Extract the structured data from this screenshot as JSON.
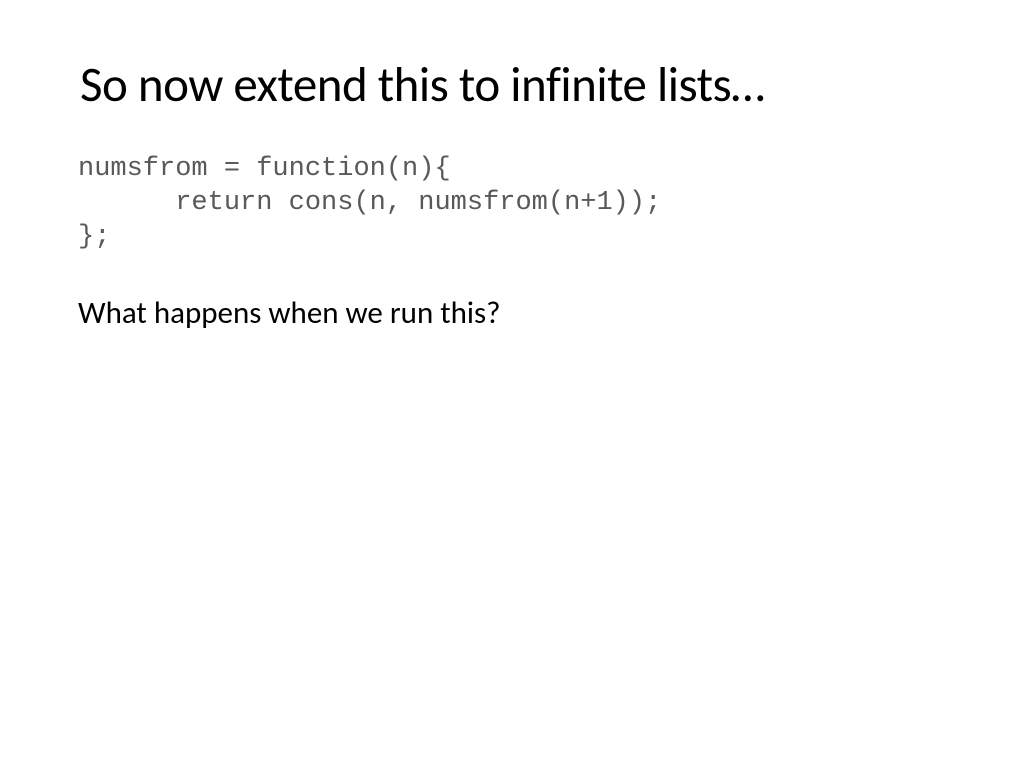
{
  "slide": {
    "title": "So now extend this to infinite lists…",
    "code": "numsfrom = function(n){\n      return cons(n, numsfrom(n+1));\n};",
    "body": "What happens when we run this?"
  }
}
